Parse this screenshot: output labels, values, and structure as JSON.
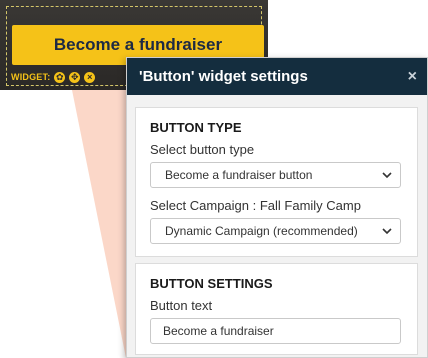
{
  "preview": {
    "button_label": "Become a fundraiser",
    "widget_label": "WIDGET:",
    "icons": [
      "gear-icon",
      "move-icon",
      "close-icon"
    ],
    "button_color": "#f5c218",
    "button_text_color": "#1d2a44"
  },
  "panel": {
    "title": "'Button' widget settings",
    "close_glyph": "×",
    "header_color": "#142d3e"
  },
  "button_type": {
    "heading": "BUTTON TYPE",
    "select_type_label": "Select button type",
    "select_type_value": "Become a fundraiser button",
    "campaign_label": "Select Campaign : Fall Family Camp",
    "campaign_value": "Dynamic Campaign (recommended)"
  },
  "button_settings": {
    "heading": "BUTTON SETTINGS",
    "text_label": "Button text",
    "text_value": "Become a fundraiser"
  }
}
